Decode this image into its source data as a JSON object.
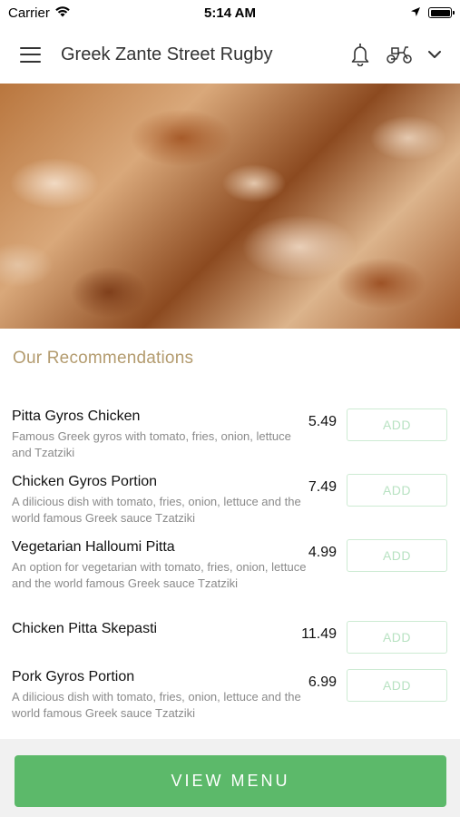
{
  "status_bar": {
    "carrier": "Carrier",
    "time": "5:14 AM"
  },
  "header": {
    "title": "Greek Zante Street Rugby",
    "icons": [
      "menu-icon",
      "bell-icon",
      "scooter-icon",
      "chevron-down-icon"
    ]
  },
  "hero": {
    "image": "gyros-meat-photo"
  },
  "recommendations": {
    "title": "Our Recommendations",
    "items": [
      {
        "name": "Pitta Gyros Chicken",
        "description": "Famous Greek gyros with tomato, fries, onion, lettuce and Tzatziki",
        "price": "5.49",
        "button": "ADD"
      },
      {
        "name": "Chicken Gyros Portion",
        "description": "A dilicious dish with tomato, fries, onion, lettuce and the world famous Greek sauce Tzatziki",
        "price": "7.49",
        "button": "ADD"
      },
      {
        "name": "Vegetarian Halloumi Pitta",
        "description": "An option for vegetarian with tomato, fries, onion, lettuce and the world famous Greek sauce Tzatziki",
        "price": "4.99",
        "button": "ADD"
      },
      {
        "name": "Chicken Pitta Skepasti",
        "description": "",
        "price": "11.49",
        "button": "ADD"
      },
      {
        "name": "Pork Gyros Portion",
        "description": "A dilicious dish with tomato, fries, onion, lettuce and the world famous Greek sauce Tzatziki",
        "price": "6.99",
        "button": "ADD"
      }
    ]
  },
  "footer": {
    "view_menu_label": "VIEW MENU"
  },
  "colors": {
    "accent_green": "#5cb96a",
    "section_title": "#b39b6e",
    "add_button_border": "#cdebd3"
  }
}
